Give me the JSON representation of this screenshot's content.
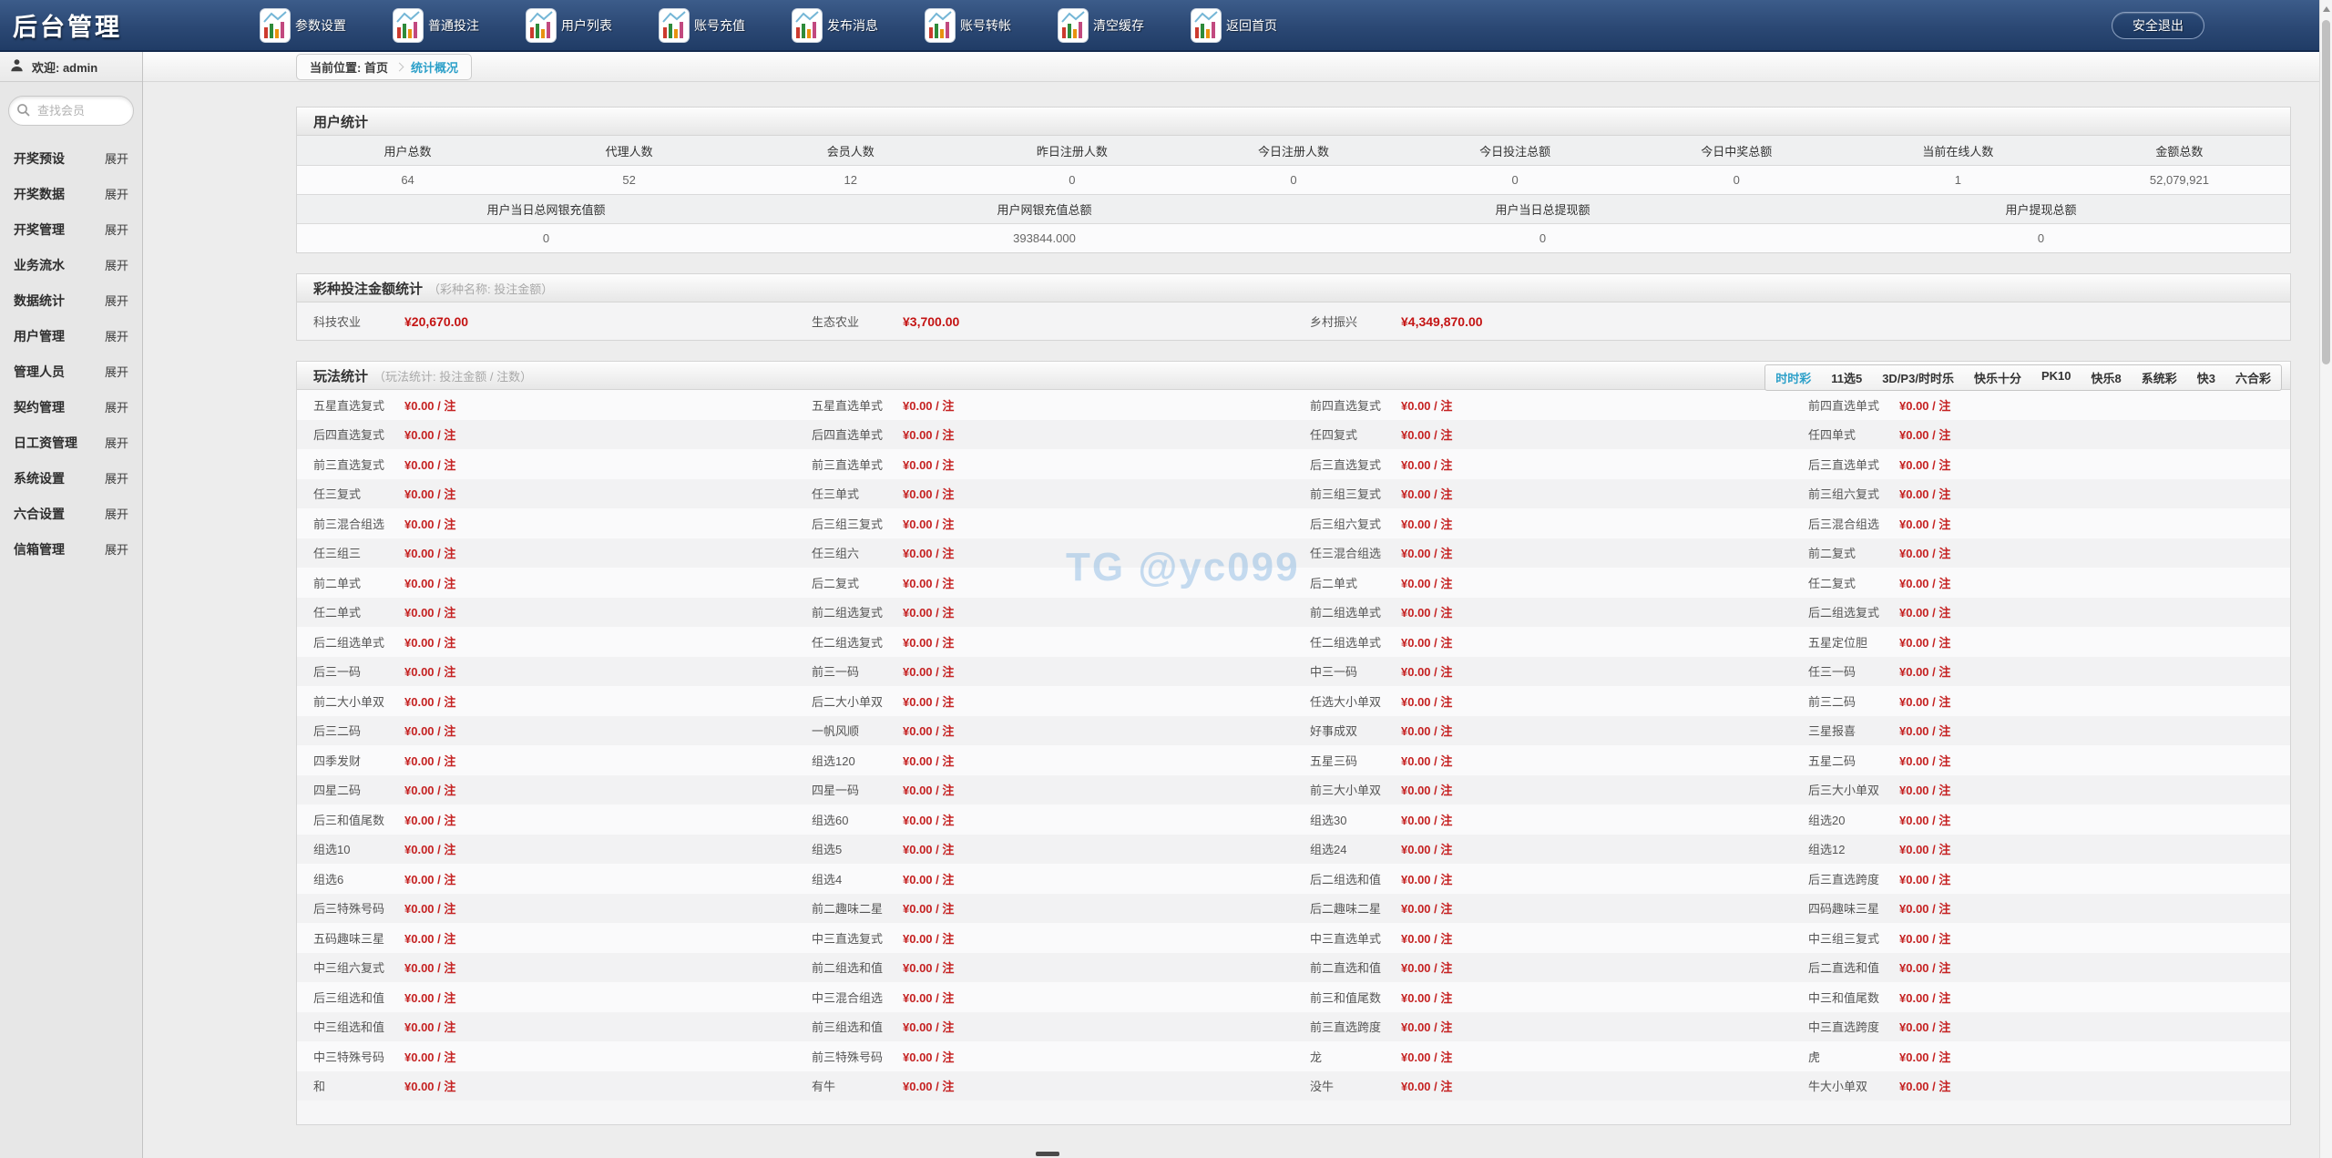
{
  "navbar": {
    "title": "后台管理",
    "items": [
      {
        "label": "参数设置"
      },
      {
        "label": "普通投注"
      },
      {
        "label": "用户列表"
      },
      {
        "label": "账号充值"
      },
      {
        "label": "发布消息"
      },
      {
        "label": "账号转帐"
      },
      {
        "label": "清空缓存"
      },
      {
        "label": "返回首页"
      }
    ],
    "logout_label": "安全退出"
  },
  "sidebar": {
    "welcome": "欢迎: admin",
    "search_placeholder": "查找会员",
    "items": [
      {
        "label": "开奖预设",
        "expand": "展开"
      },
      {
        "label": "开奖数据",
        "expand": "展开"
      },
      {
        "label": "开奖管理",
        "expand": "展开"
      },
      {
        "label": "业务流水",
        "expand": "展开"
      },
      {
        "label": "数据统计",
        "expand": "展开"
      },
      {
        "label": "用户管理",
        "expand": "展开"
      },
      {
        "label": "管理人员",
        "expand": "展开"
      },
      {
        "label": "契约管理",
        "expand": "展开"
      },
      {
        "label": "日工资管理",
        "expand": "展开"
      },
      {
        "label": "系统设置",
        "expand": "展开"
      },
      {
        "label": "六合设置",
        "expand": "展开"
      },
      {
        "label": "信箱管理",
        "expand": "展开"
      }
    ]
  },
  "breadcrumb": {
    "prefix": "当前位置: 首页",
    "current": "统计概况"
  },
  "user_stats": {
    "title": "用户统计",
    "rows": [
      {
        "headers": [
          "用户总数",
          "代理人数",
          "会员人数",
          "昨日注册人数",
          "今日注册人数",
          "今日投注总额",
          "今日中奖总额",
          "当前在线人数",
          "金额总数"
        ],
        "values": [
          "64",
          "52",
          "12",
          "0",
          "0",
          "0",
          "0",
          "1",
          "52,079,921"
        ]
      },
      {
        "headers": [
          "用户当日总网银充值额",
          "用户网银充值总额",
          "用户当日总提现额",
          "用户提现总额"
        ],
        "values": [
          "0",
          "393844.000",
          "0",
          "0"
        ]
      }
    ]
  },
  "lottery_stats": {
    "title": "彩种投注金额统计",
    "hint": "（彩种名称: 投注金额）",
    "items": [
      {
        "name": "科技农业",
        "amount": "¥20,670.00"
      },
      {
        "name": "生态农业",
        "amount": "¥3,700.00"
      },
      {
        "name": "乡村振兴",
        "amount": "¥4,349,870.00"
      }
    ]
  },
  "play_stats": {
    "title": "玩法统计",
    "hint": "（玩法统计: 投注金额 / 注数）",
    "tabs": [
      {
        "label": "时时彩",
        "active": true
      },
      {
        "label": "11选5",
        "active": false
      },
      {
        "label": "3D/P3/时时乐",
        "active": false
      },
      {
        "label": "快乐十分",
        "active": false
      },
      {
        "label": "PK10",
        "active": false
      },
      {
        "label": "快乐8",
        "active": false
      },
      {
        "label": "系统彩",
        "active": false
      },
      {
        "label": "快3",
        "active": false
      },
      {
        "label": "六合彩",
        "active": false
      }
    ],
    "cell_value": "¥0.00 / 注",
    "rows": [
      [
        "五星直选复式",
        "五星直选单式",
        "前四直选复式",
        "前四直选单式"
      ],
      [
        "后四直选复式",
        "后四直选单式",
        "任四复式",
        "任四单式"
      ],
      [
        "前三直选复式",
        "前三直选单式",
        "后三直选复式",
        "后三直选单式"
      ],
      [
        "任三复式",
        "任三单式",
        "前三组三复式",
        "前三组六复式"
      ],
      [
        "前三混合组选",
        "后三组三复式",
        "后三组六复式",
        "后三混合组选"
      ],
      [
        "任三组三",
        "任三组六",
        "任三混合组选",
        "前二复式"
      ],
      [
        "前二单式",
        "后二复式",
        "后二单式",
        "任二复式"
      ],
      [
        "任二单式",
        "前二组选复式",
        "前二组选单式",
        "后二组选复式"
      ],
      [
        "后二组选单式",
        "任二组选复式",
        "任二组选单式",
        "五星定位胆"
      ],
      [
        "后三一码",
        "前三一码",
        "中三一码",
        "任三一码"
      ],
      [
        "前二大小单双",
        "后二大小单双",
        "任选大小单双",
        "前三二码"
      ],
      [
        "后三二码",
        "一帆风顺",
        "好事成双",
        "三星报喜"
      ],
      [
        "四季发财",
        "组选120",
        "五星三码",
        "五星二码"
      ],
      [
        "四星二码",
        "四星一码",
        "前三大小单双",
        "后三大小单双"
      ],
      [
        "后三和值尾数",
        "组选60",
        "组选30",
        "组选20"
      ],
      [
        "组选10",
        "组选5",
        "组选24",
        "组选12"
      ],
      [
        "组选6",
        "组选4",
        "后二组选和值",
        "后三直选跨度"
      ],
      [
        "后三特殊号码",
        "前二趣味二星",
        "后二趣味二星",
        "四码趣味三星"
      ],
      [
        "五码趣味三星",
        "中三直选复式",
        "中三直选单式",
        "中三组三复式"
      ],
      [
        "中三组六复式",
        "前二组选和值",
        "前二直选和值",
        "后二直选和值"
      ],
      [
        "后三组选和值",
        "中三混合组选",
        "前三和值尾数",
        "中三和值尾数"
      ],
      [
        "中三组选和值",
        "前三组选和值",
        "前三直选跨度",
        "中三直选跨度"
      ],
      [
        "中三特殊号码",
        "前三特殊号码",
        "龙",
        "虎"
      ],
      [
        "和",
        "有牛",
        "没牛",
        "牛大小单双"
      ]
    ]
  },
  "watermark": "TG @yc099",
  "icons": {
    "nav_item": "chart-icon",
    "sidebar_user": "user-icon",
    "search": "search-icon",
    "breadcrumb_separator": "chevron-right-icon"
  },
  "colors": {
    "navbar": "#2b4874",
    "accent_blue": "#2da0c9",
    "value_red": "#c52222",
    "sidebar_bg": "#e7e7e7"
  }
}
